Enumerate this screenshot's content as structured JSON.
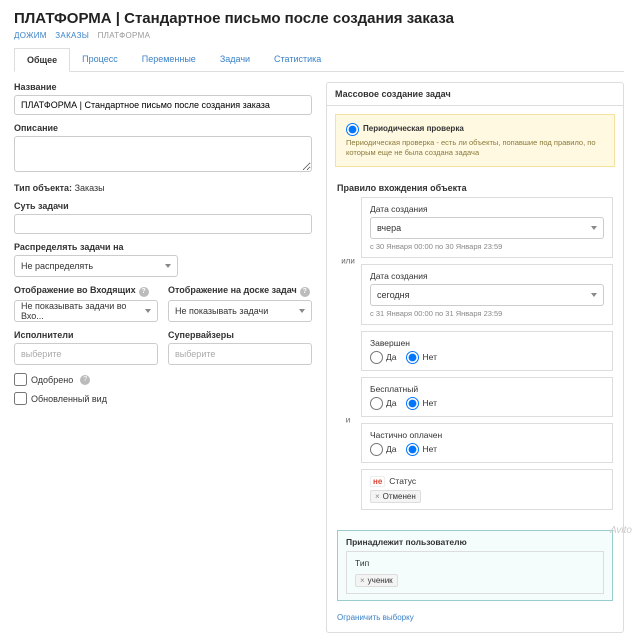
{
  "title": "ПЛАТФОРМА | Стандартное письмо после создания заказа",
  "breadcrumbs": {
    "items": [
      "ДОЖИМ",
      "ЗАКАЗЫ"
    ],
    "current": "ПЛАТФОРМА"
  },
  "tabs": [
    "Общее",
    "Процесс",
    "Переменные",
    "Задачи",
    "Статистика"
  ],
  "activeTab": 0,
  "left": {
    "name_label": "Название",
    "name_value": "ПЛАТФОРМА | Стандартное письмо после создания заказа",
    "desc_label": "Описание",
    "desc_value": "",
    "obj_type_label": "Тип объекта:",
    "obj_type_value": "Заказы",
    "task_essence_label": "Суть задачи",
    "task_essence_value": "",
    "assign_label": "Распределять задачи на",
    "assign_value": "Не распределять",
    "display_incoming_label": "Отображение во Входящих",
    "display_incoming_value": "Не показывать задачи во Вхо...",
    "display_board_label": "Отображение на доске задач",
    "display_board_value": "Не показывать задачи",
    "executors_label": "Исполнители",
    "executors_value": "выберите",
    "supervisors_label": "Супервайзеры",
    "supervisors_value": "выберите",
    "approved_label": "Одобрено",
    "updated_view_label": "Обновленный вид"
  },
  "right": {
    "panel_title": "Массовое создание задач",
    "periodic_label": "Периодическая проверка",
    "periodic_desc": "Периодическая проверка - есть ли объекты, попавшие под правило, по которым еще не была создана задача",
    "rule_section": "Правило вхождения объекта",
    "or_label": "или",
    "and_label": "и",
    "date_groups": [
      {
        "label": "Дата создания",
        "value": "вчера",
        "hint": "с 30 Января 00:00 по 30 Января 23:59"
      },
      {
        "label": "Дата создания",
        "value": "сегодня",
        "hint": "с 31 Января 00:00 по 31 Января 23:59"
      }
    ],
    "bool_groups": [
      {
        "label": "Завершен",
        "yes": "Да",
        "no": "Нет",
        "selected": "no"
      },
      {
        "label": "Бесплатный",
        "yes": "Да",
        "no": "Нет",
        "selected": "no"
      },
      {
        "label": "Частично оплачен",
        "yes": "Да",
        "no": "Нет",
        "selected": "no"
      }
    ],
    "status": {
      "ne_badge": "не",
      "label": "Статус",
      "tag": "Отменен"
    },
    "user": {
      "title": "Принадлежит пользователю",
      "type_label": "Тип",
      "type_tag": "ученик"
    },
    "limit_link": "Ограничить выборку"
  },
  "watermark": "Avito"
}
